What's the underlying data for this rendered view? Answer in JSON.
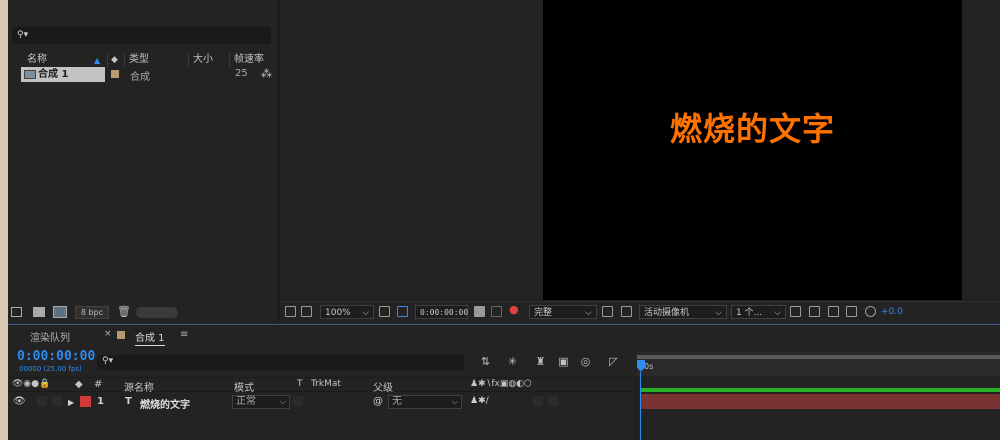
{
  "project": {
    "search_placeholder": "⚲▾",
    "columns": {
      "name": "名称",
      "type": "类型",
      "size": "大小",
      "fps": "帧速率"
    },
    "items": [
      {
        "name": "合成 1",
        "type": "合成",
        "fps": "25"
      }
    ],
    "bpc": "8 bpc"
  },
  "viewer": {
    "canvas_text": "燃烧的文字",
    "zoom": "100%",
    "timecode": "0:00:00:00",
    "resolution": "完整",
    "camera": "活动摄像机",
    "views": "1 个...",
    "exposure": "+0.0"
  },
  "timeline": {
    "tabs": {
      "render_queue": "渲染队列",
      "comp": "合成 1"
    },
    "timecode": "0:00:00:00",
    "fps": "00000 (25.00 fps)",
    "search_placeholder": "⚲▾",
    "headers": {
      "num": "#",
      "source": "源名称",
      "mode": "模式",
      "t": "T",
      "trkmat": "TrkMat",
      "parent": "父级"
    },
    "ruler_label": "0s",
    "layer": {
      "index": "1",
      "type": "T",
      "name": "燃烧的文字",
      "mode": "正常",
      "parent": "无"
    }
  },
  "colors": {
    "accent": "#2e8cf0",
    "text_fill": "#ff7200",
    "layer_label": "#d03a3a",
    "track_bar": "#7a3333",
    "track_green": "#28b028"
  }
}
